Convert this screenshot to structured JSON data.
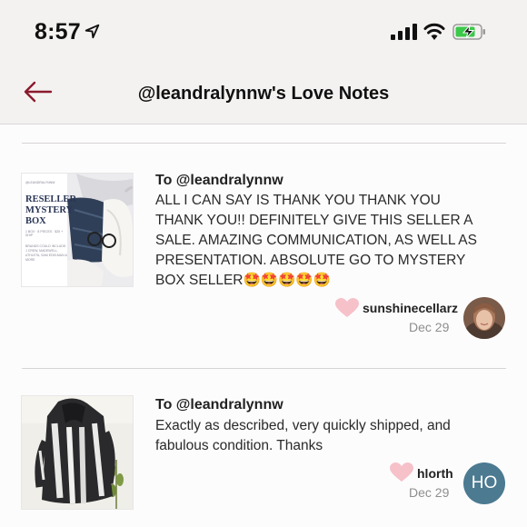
{
  "status_bar": {
    "time": "8:57"
  },
  "header": {
    "title": "@leandralynnw's Love Notes"
  },
  "notes": [
    {
      "to": "To @leandralynnw",
      "body": "ALL I CAN SAY IS THANK YOU THANK YOU THANK YOU!! DEFINITELY GIVE THIS SELLER A SALE. AMAZING COMMUNICATION, AS WELL AS PRESENTATION. ABSOLUTE GO TO MYSTERY BOX SELLER🤩🤩🤩🤩🤩",
      "user": "sunshinecellarz",
      "date": "Dec 29",
      "thumb": {
        "handle": "@LEANDRALYNNW",
        "title": "RESELLER MYSTERY BOX",
        "subtitle": "1 BOX · 8 PIECES · $25 + SHIP",
        "brands": "BRANDS COULD INCLUDE: J CREW, MADEWELL, ATHLETA, SAM EDELMAN & MORE"
      }
    },
    {
      "to": "To @leandralynnw",
      "body": "Exactly as described, very quickly shipped, and fabulous condition. Thanks",
      "user": "hlorth",
      "date": "Dec 29",
      "avatar_initials": "HO"
    }
  ],
  "colors": {
    "accent": "#8b1a2e",
    "heart": "#f6c1c9",
    "avatar_bg": "#4b7a91",
    "header_bg": "#f4f2f1"
  },
  "icons": [
    "location-arrow-icon",
    "signal-icon",
    "wifi-icon",
    "battery-charging-icon",
    "back-arrow-icon",
    "heart-icon"
  ]
}
